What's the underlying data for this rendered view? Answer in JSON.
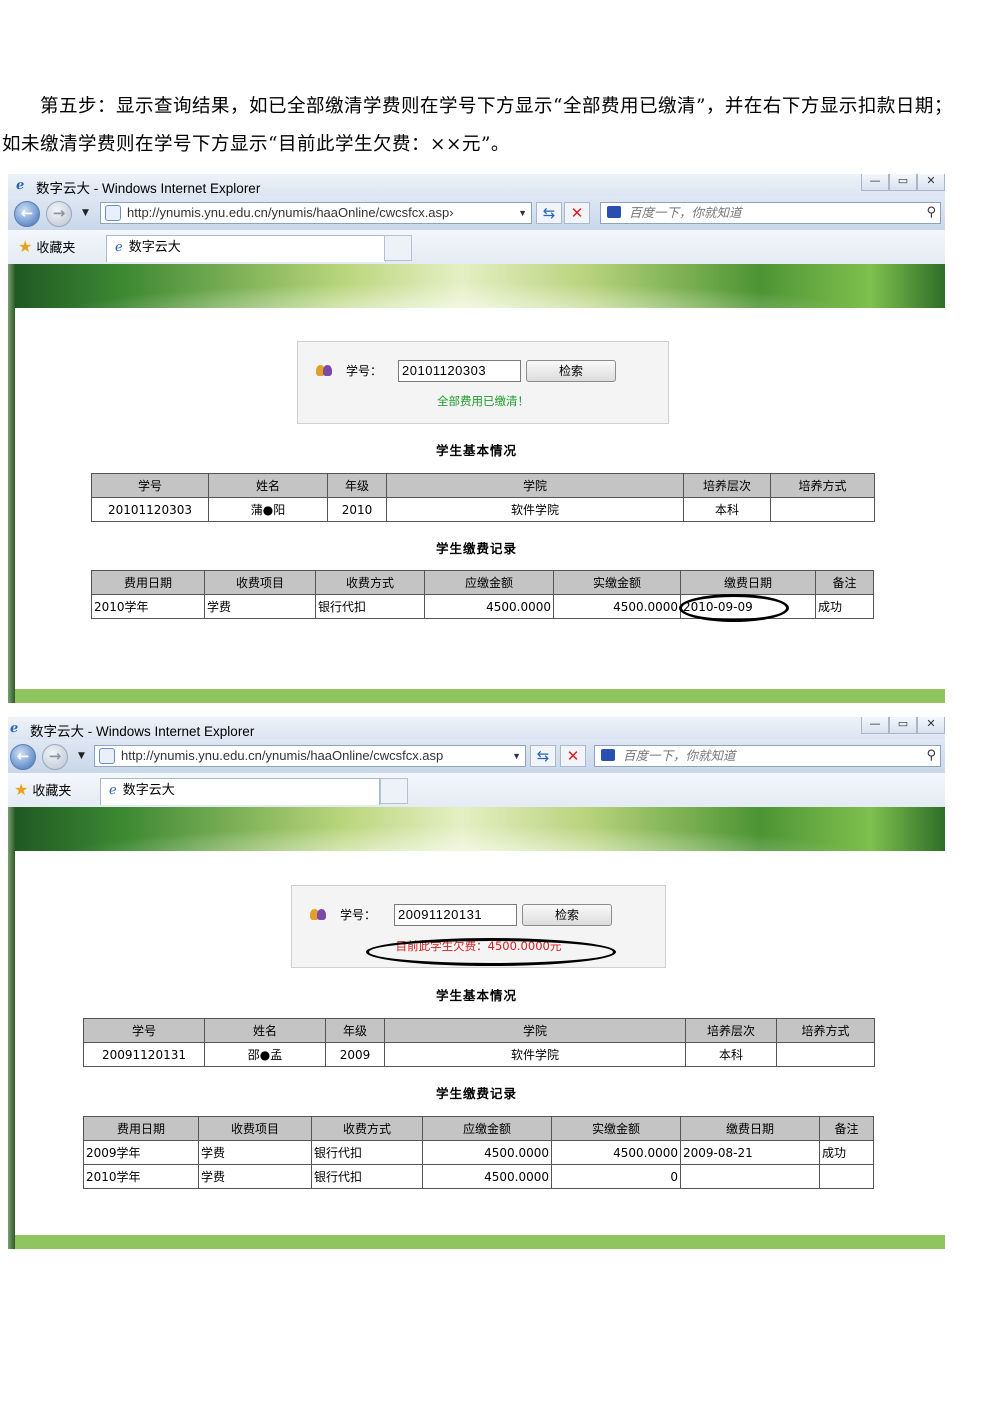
{
  "instructions": {
    "line1": "第五步：显示查询结果，如已全部缴清学费则在学号下方显示“全部费用已缴清”，并在右下方显示扣款日期；",
    "line2": "如未缴清学费则在学号下方显示“目前此学生欠费：××元”。"
  },
  "browser": {
    "window_title": "数字云大 - Windows Internet Explorer",
    "url": "http://ynumis.ynu.edu.cn/ynumis/haaOnline/cwcsfcx.asp",
    "url_truncated": "http://ynumis.ynu.edu.cn/ynumis/haaOnline/cwcsfcx.asp›",
    "search_placeholder": "百度一下，你就知道",
    "favorites_label": "收藏夹",
    "tab_title": "数字云大"
  },
  "shots": [
    {
      "student_id_label": "学号：",
      "student_id_value": "20101120303",
      "search_button": "检索",
      "status_message": "全部费用已缴清！",
      "status_color": "#1c9c2a",
      "basic_info_title": "学生基本情况",
      "basic_headers": [
        "学号",
        "姓名",
        "年级",
        "学院",
        "培养层次",
        "培养方式"
      ],
      "basic_row": [
        "20101120303",
        "蒲●阳",
        "2010",
        "软件学院",
        "本科",
        ""
      ],
      "payment_title": "学生缴费记录",
      "payment_headers": [
        "费用日期",
        "收费项目",
        "收费方式",
        "应缴金额",
        "实缴金额",
        "缴费日期",
        "备注"
      ],
      "payment_rows": [
        [
          "2010学年",
          "学费",
          "银行代扣",
          "4500.0000",
          "4500.0000",
          "2010-09-09",
          "成功"
        ]
      ]
    },
    {
      "student_id_label": "学号：",
      "student_id_value": "20091120131",
      "search_button": "检索",
      "status_message": "目前此学生欠费：4500.0000元",
      "status_color": "#d21f1f",
      "basic_info_title": "学生基本情况",
      "basic_headers": [
        "学号",
        "姓名",
        "年级",
        "学院",
        "培养层次",
        "培养方式"
      ],
      "basic_row": [
        "20091120131",
        "邵●孟",
        "2009",
        "软件学院",
        "本科",
        ""
      ],
      "payment_title": "学生缴费记录",
      "payment_headers": [
        "费用日期",
        "收费项目",
        "收费方式",
        "应缴金额",
        "实缴金额",
        "缴费日期",
        "备注"
      ],
      "payment_rows": [
        [
          "2009学年",
          "学费",
          "银行代扣",
          "4500.0000",
          "4500.0000",
          "2009-08-21",
          "成功"
        ],
        [
          "2010学年",
          "学费",
          "银行代扣",
          "4500.0000",
          "0",
          "",
          ""
        ]
      ]
    }
  ]
}
